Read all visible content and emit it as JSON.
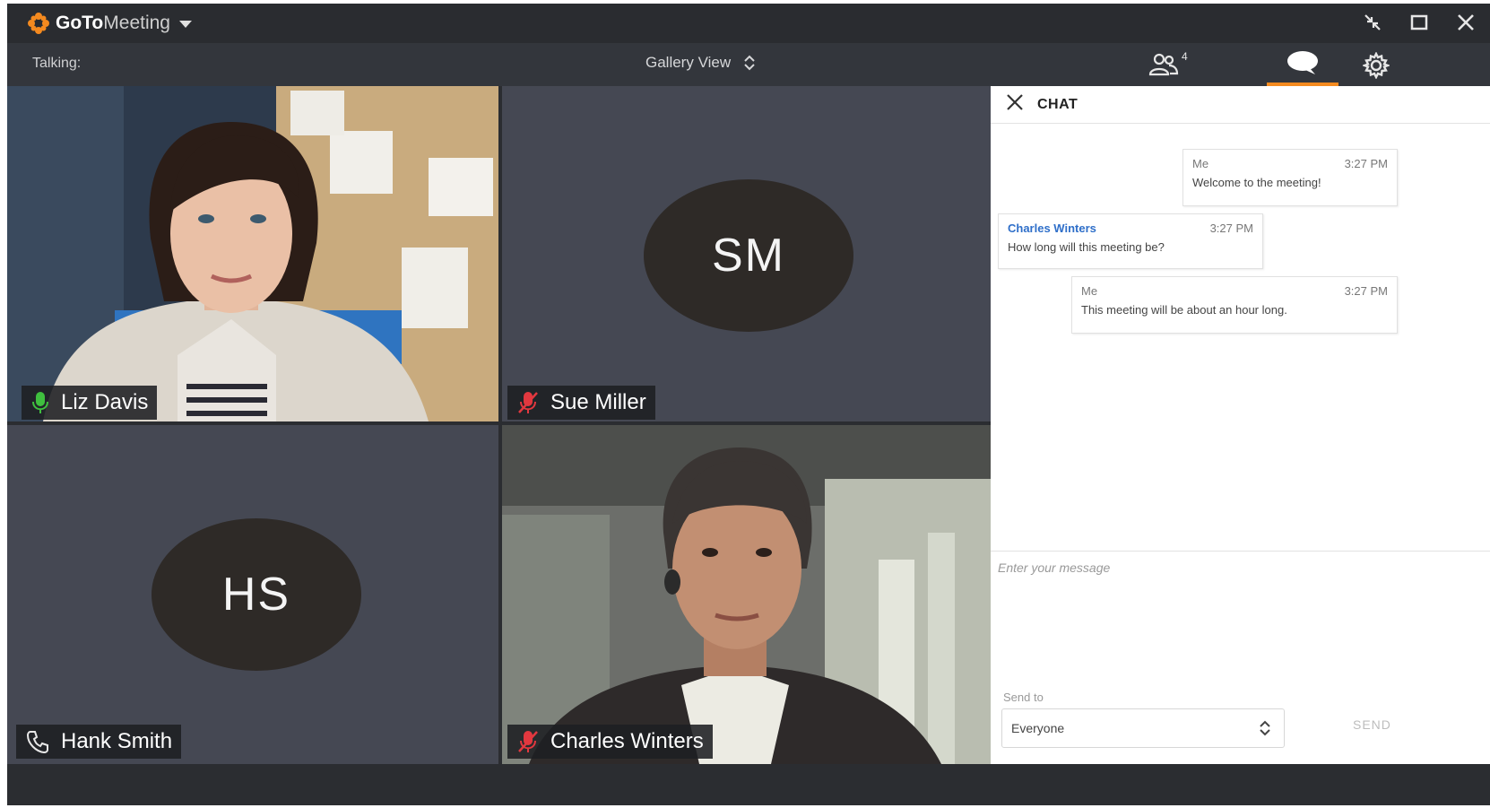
{
  "app": {
    "name_part1": "GoTo",
    "name_part2": "Meeting",
    "accent_color": "#f48a1f"
  },
  "toolbar": {
    "talking_label": "Talking:",
    "view_label": "Gallery View",
    "participant_count": "4",
    "participants_icon": "people-icon",
    "chat_icon": "chat-bubble-icon",
    "settings_icon": "gear-icon"
  },
  "tiles": [
    {
      "name": "Liz Davis",
      "type": "video",
      "status_icon": "mic-active-icon",
      "status_color": "#3fbf3f"
    },
    {
      "name": "Sue Miller",
      "type": "avatar",
      "initials": "SM",
      "status_icon": "mic-muted-icon",
      "status_color": "#e2383f"
    },
    {
      "name": "Hank Smith",
      "type": "avatar",
      "initials": "HS",
      "status_icon": "phone-icon",
      "status_color": "#e8e8e8"
    },
    {
      "name": "Charles Winters",
      "type": "video",
      "status_icon": "mic-muted-icon",
      "status_color": "#e2383f"
    }
  ],
  "chat": {
    "title": "CHAT",
    "messages": [
      {
        "sender": "Me",
        "time": "3:27 PM",
        "text": "Welcome to the meeting!"
      },
      {
        "sender": "Charles Winters",
        "time": "3:27 PM",
        "text": "How long will this meeting be?"
      },
      {
        "sender": "Me",
        "time": "3:27 PM",
        "text": "This meeting will be about an hour long."
      }
    ],
    "input_placeholder": "Enter your message",
    "send_to_label": "Send to",
    "send_to_value": "Everyone",
    "send_label": "SEND"
  }
}
